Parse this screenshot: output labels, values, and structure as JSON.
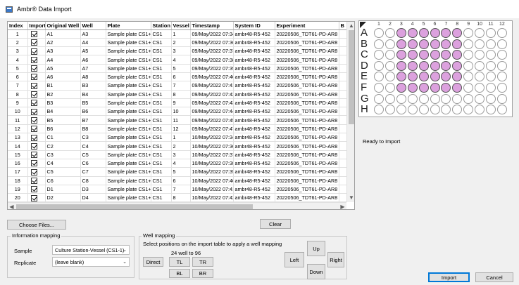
{
  "window": {
    "title": "Ambr® Data Import"
  },
  "table": {
    "columns": [
      "Index",
      "Import",
      "Original Well",
      "Well",
      "Plate",
      "Station",
      "Vessel",
      "Timestamp",
      "System ID",
      "Experiment",
      "B"
    ],
    "rows": [
      [
        "1",
        true,
        "A1",
        "A3",
        "Sample plate CS1+2",
        "CS1",
        "1",
        "09/May/2022 07:34",
        "ambr48-R5-452",
        "20220506_TDT61-PD-AR8"
      ],
      [
        "2",
        true,
        "A2",
        "A4",
        "Sample plate CS1+2",
        "CS1",
        "2",
        "09/May/2022 07:36",
        "ambr48-R5-452",
        "20220506_TDT61-PD-AR8"
      ],
      [
        "3",
        true,
        "A3",
        "A5",
        "Sample plate CS1+2",
        "CS1",
        "3",
        "09/May/2022 07:37",
        "ambr48-R5-452",
        "20220506_TDT61-PD-AR8"
      ],
      [
        "4",
        true,
        "A4",
        "A6",
        "Sample plate CS1+2",
        "CS1",
        "4",
        "09/May/2022 07:38",
        "ambr48-R5-452",
        "20220506_TDT61-PD-AR8"
      ],
      [
        "5",
        true,
        "A5",
        "A7",
        "Sample plate CS1+2",
        "CS1",
        "5",
        "09/May/2022 07:39",
        "ambr48-R5-452",
        "20220506_TDT61-PD-AR8"
      ],
      [
        "6",
        true,
        "A6",
        "A8",
        "Sample plate CS1+2",
        "CS1",
        "6",
        "09/May/2022 07:40",
        "ambr48-R5-452",
        "20220506_TDT61-PD-AR8"
      ],
      [
        "7",
        true,
        "B1",
        "B3",
        "Sample plate CS1+2",
        "CS1",
        "7",
        "09/May/2022 07:41",
        "ambr48-R5-452",
        "20220506_TDT61-PD-AR8"
      ],
      [
        "8",
        true,
        "B2",
        "B4",
        "Sample plate CS1+2",
        "CS1",
        "8",
        "09/May/2022 07:42",
        "ambr48-R5-452",
        "20220506_TDT61-PD-AR8"
      ],
      [
        "9",
        true,
        "B3",
        "B5",
        "Sample plate CS1+2",
        "CS1",
        "9",
        "09/May/2022 07:43",
        "ambr48-R5-452",
        "20220506_TDT61-PD-AR8"
      ],
      [
        "10",
        true,
        "B4",
        "B6",
        "Sample plate CS1+2",
        "CS1",
        "10",
        "09/May/2022 07:44",
        "ambr48-R5-452",
        "20220506_TDT61-PD-AR8"
      ],
      [
        "11",
        true,
        "B5",
        "B7",
        "Sample plate CS1+2",
        "CS1",
        "11",
        "09/May/2022 07:45",
        "ambr48-R5-452",
        "20220506_TDT61-PD-AR8"
      ],
      [
        "12",
        true,
        "B6",
        "B8",
        "Sample plate CS1+2",
        "CS1",
        "12",
        "09/May/2022 07:47",
        "ambr48-R5-452",
        "20220506_TDT61-PD-AR8"
      ],
      [
        "13",
        true,
        "C1",
        "C3",
        "Sample plate CS1+2",
        "CS1",
        "1",
        "10/May/2022 07:34",
        "ambr48-R5-452",
        "20220506_TDT61-PD-AR8"
      ],
      [
        "14",
        true,
        "C2",
        "C4",
        "Sample plate CS1+2",
        "CS1",
        "2",
        "10/May/2022 07:36",
        "ambr48-R5-452",
        "20220506_TDT61-PD-AR8"
      ],
      [
        "15",
        true,
        "C3",
        "C5",
        "Sample plate CS1+2",
        "CS1",
        "3",
        "10/May/2022 07:37",
        "ambr48-R5-452",
        "20220506_TDT61-PD-AR8"
      ],
      [
        "16",
        true,
        "C4",
        "C6",
        "Sample plate CS1+2",
        "CS1",
        "4",
        "10/May/2022 07:38",
        "ambr48-R5-452",
        "20220506_TDT61-PD-AR8"
      ],
      [
        "17",
        true,
        "C5",
        "C7",
        "Sample plate CS1+2",
        "CS1",
        "5",
        "10/May/2022 07:39",
        "ambr48-R5-452",
        "20220506_TDT61-PD-AR8"
      ],
      [
        "18",
        true,
        "C6",
        "C8",
        "Sample plate CS1+2",
        "CS1",
        "6",
        "10/May/2022 07:40",
        "ambr48-R5-452",
        "20220506_TDT61-PD-AR8"
      ],
      [
        "19",
        true,
        "D1",
        "D3",
        "Sample plate CS1+2",
        "CS1",
        "7",
        "10/May/2022 07:41",
        "ambr48-R5-452",
        "20220506_TDT61-PD-AR8"
      ],
      [
        "20",
        true,
        "D2",
        "D4",
        "Sample plate CS1+2",
        "CS1",
        "8",
        "10/May/2022 07:42",
        "ambr48-R5-452",
        "20220506_TDT61-PD-AR8"
      ]
    ]
  },
  "plate": {
    "columns": [
      "1",
      "2",
      "3",
      "4",
      "5",
      "6",
      "7",
      "8",
      "9",
      "10",
      "11",
      "12"
    ],
    "rows": [
      "A",
      "B",
      "C",
      "D",
      "E",
      "F",
      "G",
      "H"
    ],
    "filled_rows": [
      "A",
      "B",
      "C",
      "D",
      "E",
      "F"
    ],
    "filled_columns": [
      "3",
      "4",
      "5",
      "6",
      "7",
      "8"
    ],
    "fill_color": "#dca1de"
  },
  "status": "Ready to Import",
  "buttons": {
    "choose_files": "Choose Files...",
    "clear": "Clear",
    "import": "Import",
    "cancel": "Cancel"
  },
  "info_mapping": {
    "legend": "Information mapping",
    "sample_label": "Sample",
    "sample_value": "Culture Station-Vessel (CS1-1)",
    "replicate_label": "Replicate",
    "replicate_value": "(leave blank)"
  },
  "well_mapping": {
    "legend": "Well mapping",
    "instruction": "Select positions on the import table to apply a well mapping",
    "mode": "24 well to 96",
    "direct": "Direct",
    "tl": "TL",
    "tr": "TR",
    "bl": "BL",
    "br": "BR",
    "up": "Up",
    "left": "Left",
    "down": "Down",
    "right": "Right"
  }
}
